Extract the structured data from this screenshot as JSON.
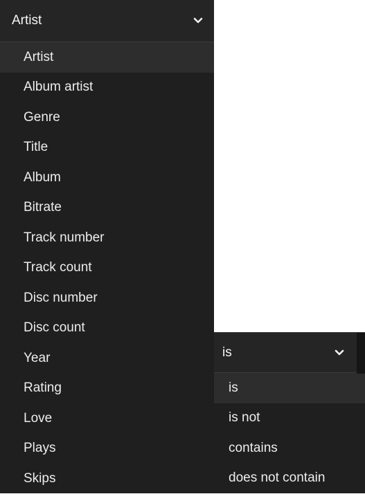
{
  "field_dropdown": {
    "selected": "Artist",
    "options": [
      "Artist",
      "Album artist",
      "Genre",
      "Title",
      "Album",
      "Bitrate",
      "Track number",
      "Track count",
      "Disc number",
      "Disc count",
      "Year",
      "Rating",
      "Love",
      "Plays",
      "Skips"
    ],
    "highlighted_option": "Artist"
  },
  "operator_dropdown": {
    "selected": "is",
    "options": [
      "is",
      "is not",
      "contains",
      "does not contain"
    ],
    "highlighted_option": "is"
  },
  "colors": {
    "background": "#1f1f1f",
    "header": "#252525",
    "highlight": "#2d2d2d",
    "text": "#ededed"
  },
  "icons": {
    "expand": "chevron-down-icon"
  }
}
